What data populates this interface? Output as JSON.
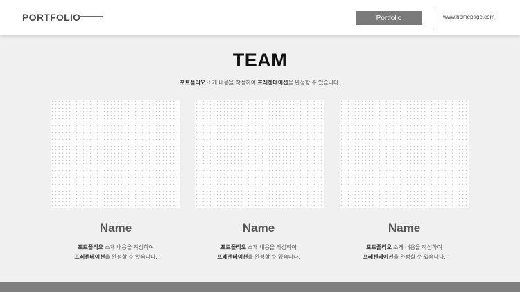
{
  "header": {
    "brand": "PORTFOLIO",
    "button_label": "Portfolio",
    "url": "www.homepage.com"
  },
  "main": {
    "title": "TEAM",
    "subtitle": {
      "bold1": "포트폴리오",
      "text1": " 소개 내용을 작성하여 ",
      "bold2": "프레젠테이션",
      "text2": "을 완성할 수 있습니다."
    }
  },
  "cards": [
    {
      "name": "Name",
      "line1_bold": "포트폴리오",
      "line1_rest": " 소개 내용을 작성하여",
      "line2_bold": "프레젠테이션",
      "line2_rest": "을 완성할 수 있습니다."
    },
    {
      "name": "Name",
      "line1_bold": "포트폴리오",
      "line1_rest": " 소개 내용을 작성하여",
      "line2_bold": "프레젠테이션",
      "line2_rest": "을 완성할 수 있습니다."
    },
    {
      "name": "Name",
      "line1_bold": "포트폴리오",
      "line1_rest": " 소개 내용을 작성하여",
      "line2_bold": "프레젠테이션",
      "line2_rest": "을 완성할 수 있습니다."
    }
  ],
  "colors": {
    "background": "#f0f0f0",
    "header_bg": "#ffffff",
    "button_bg": "#7a7a7a",
    "footer_bar": "#7f7f7f"
  }
}
